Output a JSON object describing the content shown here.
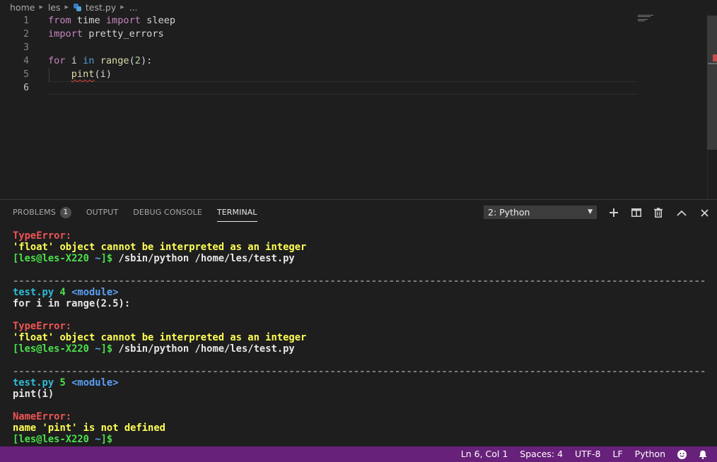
{
  "breadcrumb": {
    "items": [
      "home",
      "les",
      "test.py",
      "..."
    ]
  },
  "editor": {
    "line_numbers": [
      "1",
      "2",
      "3",
      "4",
      "5",
      "6"
    ],
    "lines": {
      "l1": {
        "kw1": "from",
        "a": " time ",
        "kw2": "import",
        "b": " sleep"
      },
      "l2": {
        "kw1": "import",
        "a": " pretty_errors"
      },
      "l4": {
        "kw1": "for",
        "a": " i ",
        "kw2": "in",
        "b": " ",
        "fn": "range",
        "c": "(",
        "num": "2",
        "d": "):"
      },
      "l5": {
        "indent": "    ",
        "err": "pint",
        "a": "(i)"
      }
    }
  },
  "panel": {
    "tabs": [
      "PROBLEMS",
      "OUTPUT",
      "DEBUG CONSOLE",
      "TERMINAL"
    ],
    "problems_count": "1",
    "terminal_select": "2: Python"
  },
  "terminal": {
    "err1_type": "TypeError:",
    "err1_msg": "'float' object cannot be interpreted as an integer",
    "prompt_user": "[les@les-X220 ",
    "prompt_path": "~",
    "prompt_end": "]$",
    "cmd": " /sbin/python /home/les/test.py",
    "dashes": "------------------------------------------------------------------------------------------------------------------------------------------------",
    "tb1_file": "test.py",
    "tb1_line": " 4 ",
    "tb1_mod": "<module>",
    "tb1_code": "for i in range(2.5):",
    "err2_type": "TypeError:",
    "err2_msg": "'float' object cannot be interpreted as an integer",
    "tb2_file": "test.py",
    "tb2_line": " 5 ",
    "tb2_mod": "<module>",
    "tb2_code": "pint(i)",
    "err3_type": "NameError:",
    "err3_msg": "name 'pint' is not defined"
  },
  "status": {
    "position": "Ln 6, Col 1",
    "spaces": "Spaces: 4",
    "encoding": "UTF-8",
    "eol": "LF",
    "language": "Python"
  },
  "colors": {
    "status_bg": "#68217a",
    "editor_bg": "#1e1e1e",
    "error_red": "#f05454",
    "message_yellow": "#ffff55",
    "prompt_green": "#4ce04c",
    "file_cyan": "#2fbcd8"
  },
  "icons": {
    "file": "python-file-icon",
    "new_terminal": "plus-icon",
    "split": "split-icon",
    "kill": "trash-icon",
    "maximize": "chevron-up-icon",
    "close": "close-icon",
    "feedback": "smiley-icon",
    "notifications": "bell-icon"
  }
}
